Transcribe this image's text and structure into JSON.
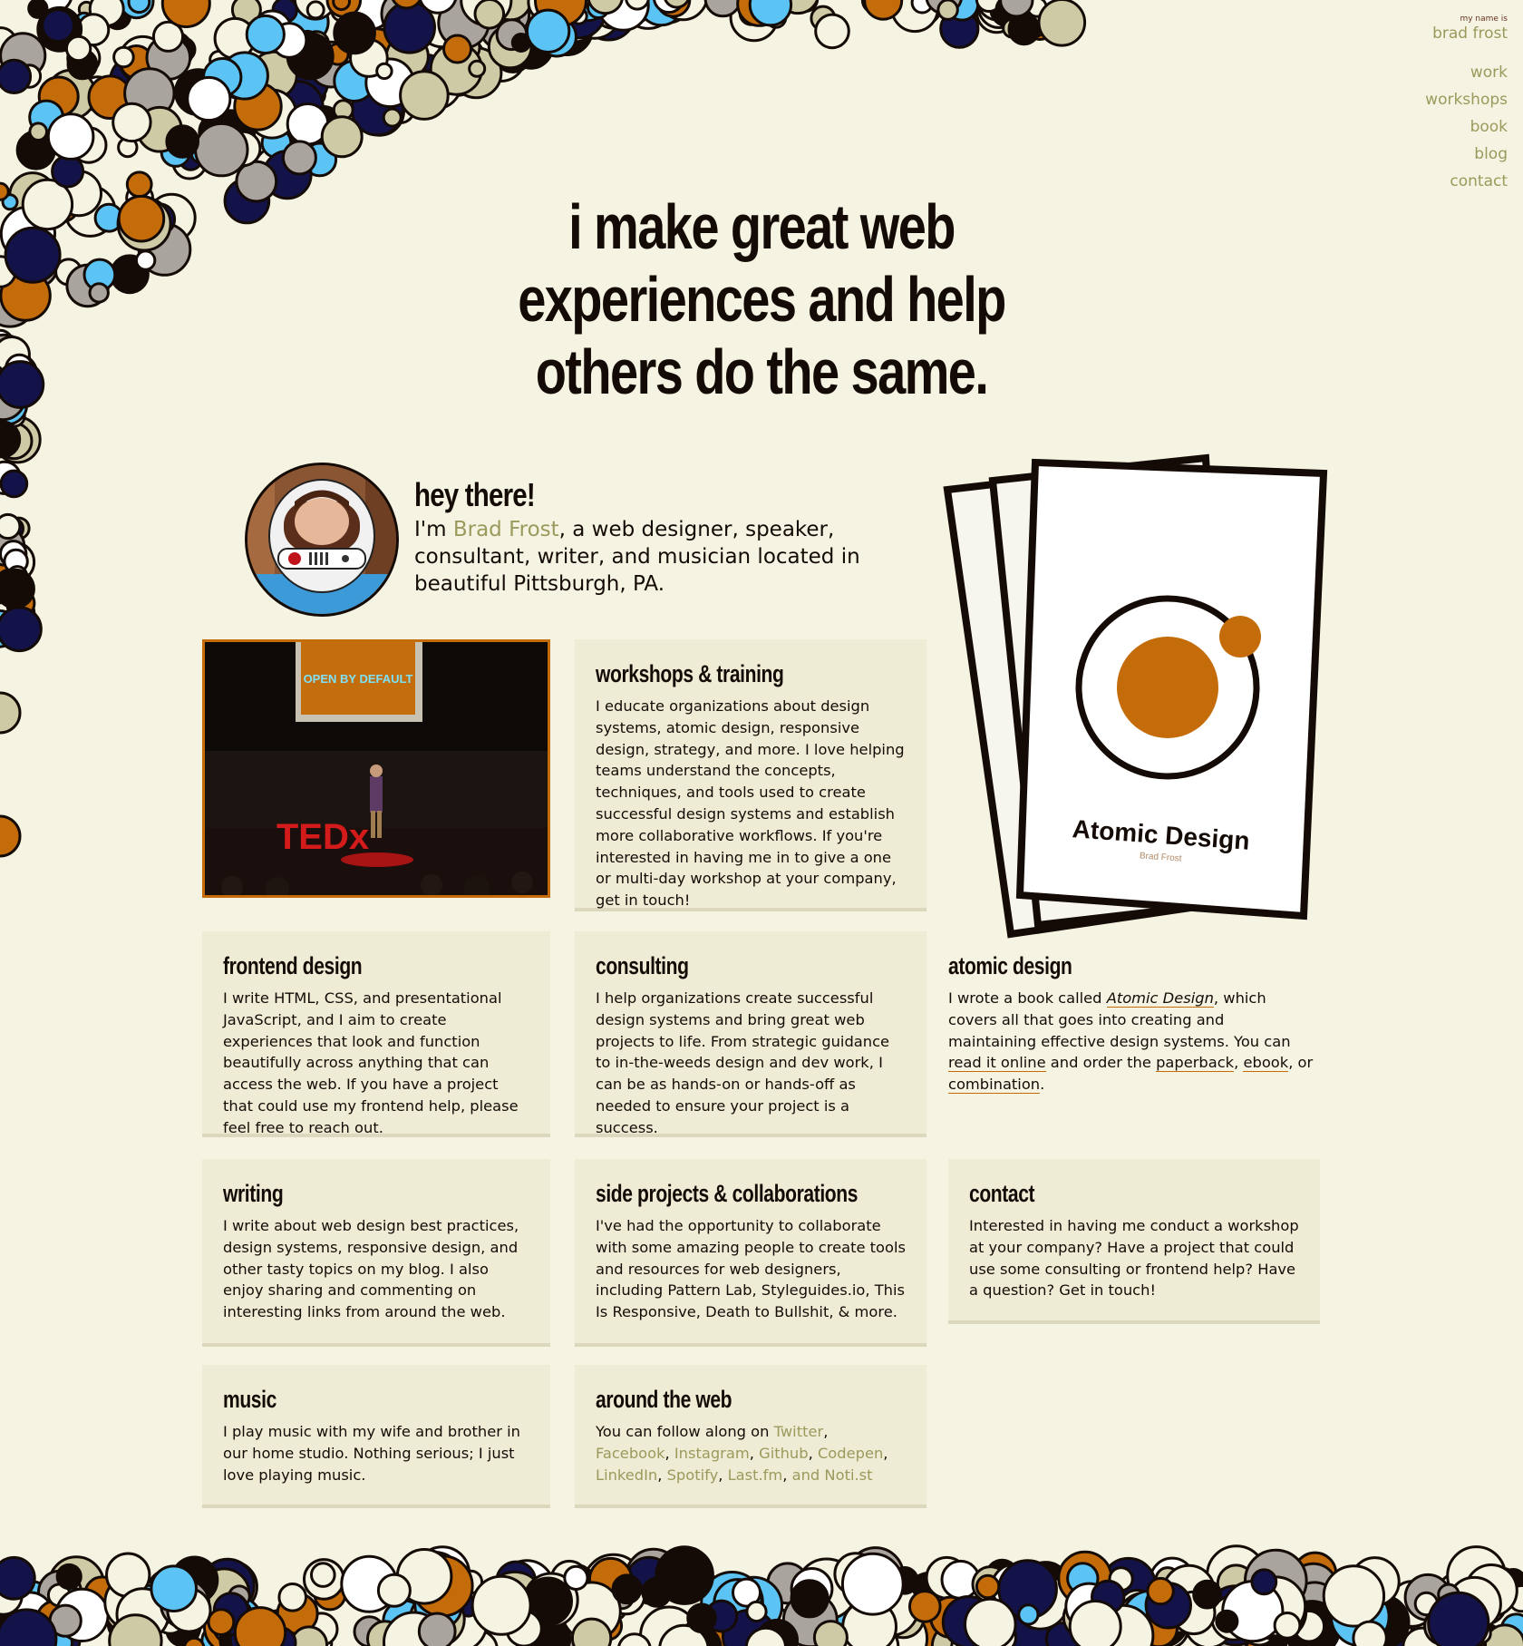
{
  "header": {
    "intro": "my name is",
    "name": "brad frost"
  },
  "nav": {
    "items": [
      "work",
      "workshops",
      "book",
      "blog",
      "contact"
    ]
  },
  "hero": {
    "line1": "i make great web",
    "line2": "experiences and help",
    "line3": "others do the same."
  },
  "intro": {
    "heading": "hey there!",
    "prefix": "I'm",
    "name_link": "Brad Frost",
    "suffix": ", a web designer, speaker, consultant, writer, and musician located in beautiful Pittsburgh, PA."
  },
  "tedx": {
    "screen_text": "OPEN BY DEFAULT",
    "logo_text": "TEDx"
  },
  "book_cover": {
    "title": "Atomic Design",
    "author": "Brad Frost"
  },
  "cards": {
    "workshops": {
      "title": "workshops & training",
      "body": "I educate organizations about design systems, atomic design, responsive design, strategy, and more. I love helping teams understand the concepts, techniques, and tools used to create successful design systems and establish more collaborative workflows. If you're interested in having me in to give a one or multi-day workshop at your company, get in touch!"
    },
    "frontend": {
      "title": "frontend design",
      "body": "I write HTML, CSS, and presentational JavaScript, and I aim to create experiences that look and function beautifully across anything that can access the web. If you have a project that could use my frontend help, please feel free to reach out."
    },
    "consulting": {
      "title": "consulting",
      "body": "I help organizations create successful design systems and bring great web projects to life. From strategic guidance to in-the-weeds design and dev work, I can be as hands-on or hands-off as needed to ensure your project is a success."
    },
    "atomic": {
      "title": "atomic design",
      "text1": "I wrote a book called ",
      "book_name": "Atomic Design",
      "text2": ", which covers all that goes into creating and maintaining effective design systems. You can ",
      "read_link": "read it online",
      "text3": " and order the ",
      "paperback_link": "paperback",
      "sep1": ", ",
      "ebook_link": "ebook",
      "sep2": ", or ",
      "combination_link": "combination",
      "end": "."
    },
    "writing": {
      "title": "writing",
      "body": "I write about web design best practices, design systems, responsive design, and other tasty topics on my blog. I also enjoy sharing and commenting on interesting links from around the web."
    },
    "side": {
      "title": "side projects & collaborations",
      "body": "I've had the opportunity to collaborate with some amazing people to create tools and resources for web designers, including Pattern Lab, Styleguides.io, This Is Responsive, Death to Bullshit, & more."
    },
    "contact": {
      "title": "contact",
      "body": "Interested in having me conduct a workshop at your company? Have a project that could use some consulting or frontend help? Have a question? Get in touch!"
    },
    "music": {
      "title": "music",
      "body": "I play music with my wife and brother in our home studio. Nothing serious; I just love playing music."
    },
    "web": {
      "title": "around the web",
      "prefix": "You can follow along on ",
      "links": [
        "Twitter",
        "Facebook",
        "Instagram",
        "Github",
        "Codepen",
        "LinkedIn",
        "Spotify",
        "Last.fm"
      ],
      "last": "and Noti.st"
    }
  },
  "colors": {
    "background": "#f5f4e2",
    "ink": "#150b06",
    "accent_orange": "#c46c0a",
    "link_olive": "#9a9a5c",
    "card_bg": "#efecd6",
    "bubble_blue": "#5bc4f5",
    "bubble_navy": "#13134a"
  },
  "icons": {
    "avatar": "astronaut-helmet-portrait",
    "book_logo": "atom-icon"
  }
}
